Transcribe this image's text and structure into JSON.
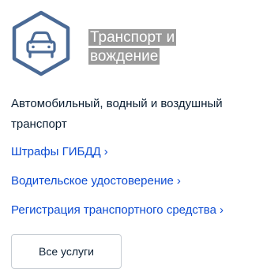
{
  "category": {
    "icon": "car-icon",
    "title": "Транспорт и вождение",
    "description": "Автомобильный, водный и воздушный транспорт"
  },
  "links": [
    {
      "label": "Штрафы ГИБДД",
      "chevron": "›"
    },
    {
      "label": "Водительское удостоверение",
      "chevron": "›"
    },
    {
      "label": "Регистрация транспортного средства",
      "chevron": "›"
    }
  ],
  "all_services_button": {
    "label": "Все услуги"
  },
  "colors": {
    "icon_stroke": "#4a6a96",
    "link": "#0d4cd3",
    "text": "#0b1f33",
    "title_highlight": "#9a9a9a",
    "button_border": "#c8ced4"
  }
}
